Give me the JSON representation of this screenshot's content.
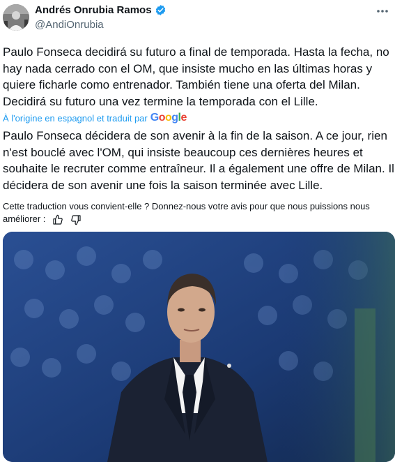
{
  "author": {
    "name": "Andrés Onrubia Ramos",
    "handle": "@AndiOnrubia",
    "verified": true,
    "avatar_icon": "avatar-photo",
    "more_icon": "more-horizontal-icon"
  },
  "tweet": {
    "text": "Paulo Fonseca decidirá su futuro a final de temporada. Hasta la fecha, no hay nada cerrado con el OM, que insiste mucho en las últimas horas y quiere ficharle como entrenador. También tiene una oferta del Milan. Decidirá su futuro una vez termine la temporada con el Lille."
  },
  "translation": {
    "label": "À l'origine en espagnol et traduit par",
    "provider": "Google",
    "text": "Paulo Fonseca décidera de son avenir à la fin de la saison. A ce jour, rien n'est bouclé avec l'OM, qui insiste beaucoup ces dernières heures et souhaite le recruter comme entraîneur. Il a également une offre de Milan. Il décidera de son avenir une fois la saison terminée avec Lille.",
    "feedback_prompt": "Cette traduction vous convient-elle ? Donnez-nous votre avis pour que nous puissions nous améliorer :"
  },
  "icons": {
    "thumbs_up": "thumbs-up-icon",
    "thumbs_down": "thumbs-down-icon",
    "verified": "verified-badge-icon"
  },
  "colors": {
    "link": "#1d9bf0",
    "secondary_text": "#536471",
    "primary_text": "#0f1419",
    "verified": "#1d9bf0",
    "google_blue": "#4285f4",
    "google_red": "#ea4335",
    "google_yellow": "#fbbc05",
    "google_green": "#34a853"
  }
}
